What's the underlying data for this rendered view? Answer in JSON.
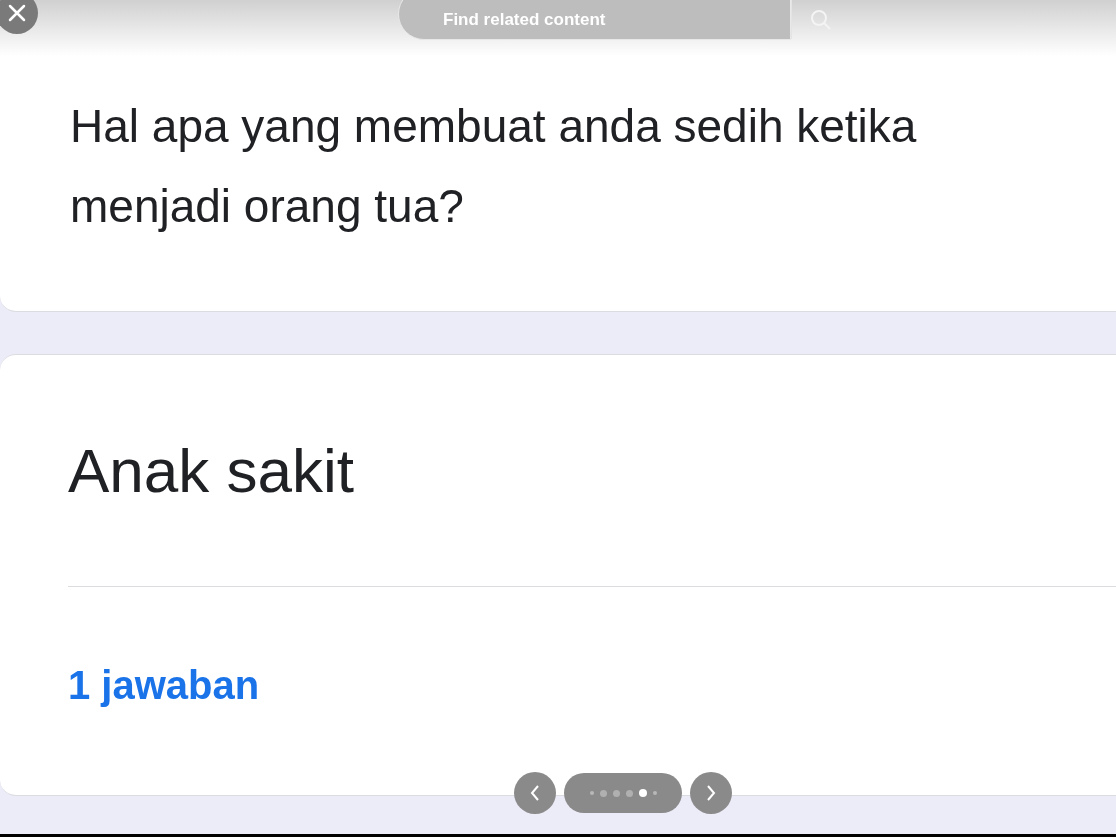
{
  "overlay": {
    "search": {
      "placeholder": "Find related content"
    }
  },
  "question": {
    "title": "Hal apa yang membuat anda sedih ketika menjadi orang tua?"
  },
  "answer": {
    "text": "Anak sakit",
    "count": "1 jawaban"
  },
  "pager": {
    "pages": [
      {
        "selected": false
      },
      {
        "selected": false
      },
      {
        "selected": false
      },
      {
        "selected": false
      },
      {
        "selected": true
      },
      {
        "selected": false
      }
    ]
  }
}
